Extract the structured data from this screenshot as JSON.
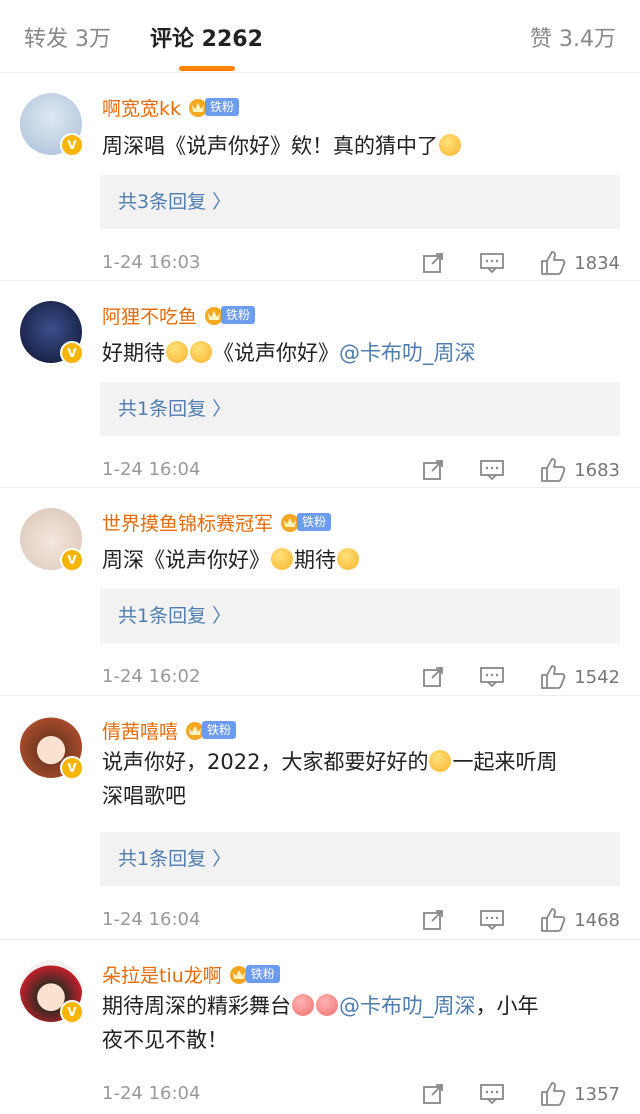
{
  "tabs": {
    "repost": "转发 3万",
    "comments": "评论 2262",
    "likes": "赞 3.4万"
  },
  "fan_tag": "铁粉",
  "comments": [
    {
      "name": "啊宽宽kk",
      "text": "周深唱《说声你好》欸！真的猜中了",
      "replies": "共3条回复 〉",
      "time": "1-24 16:03",
      "likes": "1834"
    },
    {
      "name": "阿狸不吃鱼",
      "text_pre": "好期待",
      "text_mid": "《说声你好》",
      "mention": "@卡布叻_周深",
      "replies": "共1条回复 〉",
      "time": "1-24 16:04",
      "likes": "1683"
    },
    {
      "name": "世界摸鱼锦标赛冠军",
      "text_pre": "周深《说声你好》",
      "text_post": "期待",
      "replies": "共1条回复 〉",
      "time": "1-24 16:02",
      "likes": "1542"
    },
    {
      "name": "倩茜嘻嘻",
      "text_l1_pre": "说声你好，2022，大家都要好好的",
      "text_l1_post": "一起来听周",
      "text_l2": "深唱歌吧",
      "replies": "共1条回复 〉",
      "time": "1-24 16:04",
      "likes": "1468"
    },
    {
      "name": "朵拉是tiu龙啊",
      "text_l1_pre": "期待周深的精彩舞台",
      "mention": "@卡布叻_周深",
      "text_l1_post": "，小年",
      "text_l2": "夜不见不散！",
      "time": "1-24 16:04",
      "likes": "1357"
    }
  ],
  "colors": {
    "accent": "#ff8200",
    "username": "#e86b0b",
    "link": "#507daf",
    "badge": "#f7b500"
  }
}
